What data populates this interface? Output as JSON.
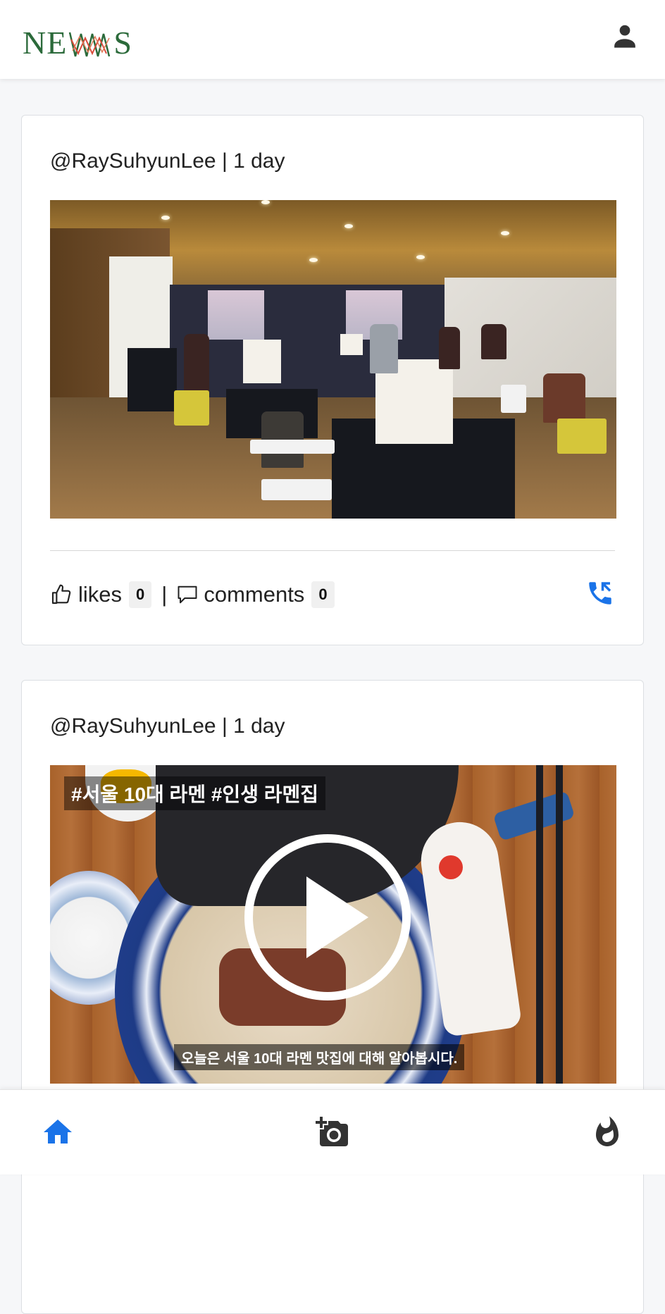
{
  "header": {
    "logo_text_left": "NE",
    "logo_text_right": "S"
  },
  "posts": [
    {
      "meta": "@RaySuhyunLee | 1 day",
      "likes_label": "likes",
      "likes_count": "0",
      "separator": "|",
      "comments_label": "comments",
      "comments_count": "0"
    },
    {
      "meta": "@RaySuhyunLee | 1 day",
      "caption_top": "#서울 10대 라멘 #인생 라멘집",
      "caption_bottom": "오늘은 서울 10대 라멘 맛집에 대해 알아봅시다."
    }
  ],
  "colors": {
    "accent": "#1a73e8",
    "logo_green": "#2b6a3a",
    "logo_red": "#d94a3a",
    "icon_dark": "#333333"
  },
  "icons": {
    "user": "user-icon",
    "like": "thumbs-up-icon",
    "comment": "comment-icon",
    "call": "phone-callback-icon",
    "play": "play-icon",
    "home": "home-icon",
    "add_photo": "add-photo-icon",
    "trending": "fire-icon"
  }
}
